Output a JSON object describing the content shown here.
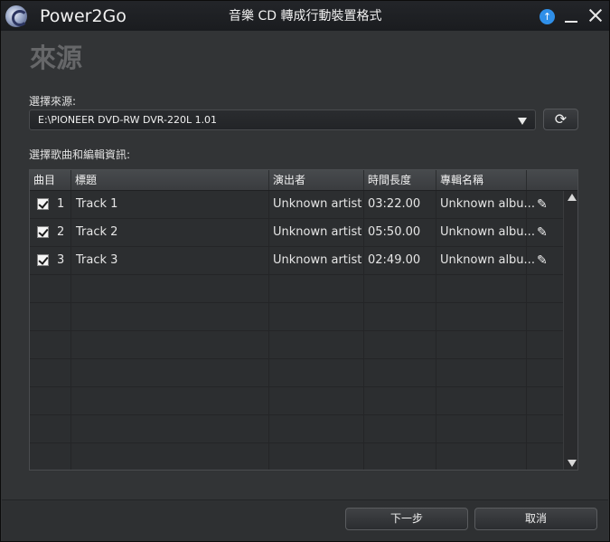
{
  "titlebar": {
    "app_name": "Power2Go",
    "window_title": "音樂 CD 轉成行動裝置格式",
    "update_icon": "arrow-up-circle-icon",
    "update_glyph": "↑"
  },
  "page": {
    "heading": "來源"
  },
  "source": {
    "label": "選擇來源:",
    "selected": "E:\\PIONEER DVD-RW DVR-220L 1.01",
    "refresh_glyph": "⟳"
  },
  "tracks": {
    "label": "選擇歌曲和編輯資訊:",
    "columns": [
      "曲目",
      "標題",
      "演出者",
      "時間長度",
      "專輯名稱",
      ""
    ],
    "rows": [
      {
        "checked": true,
        "num": "1",
        "title": "Track 1",
        "artist": "Unknown artist",
        "duration": "03:22.00",
        "album": "Unknown albu..."
      },
      {
        "checked": true,
        "num": "2",
        "title": "Track 2",
        "artist": "Unknown artist",
        "duration": "05:50.00",
        "album": "Unknown albu..."
      },
      {
        "checked": true,
        "num": "3",
        "title": "Track 3",
        "artist": "Unknown artist",
        "duration": "02:49.00",
        "album": "Unknown albu..."
      }
    ],
    "edit_glyph": "✎"
  },
  "footer": {
    "next_label": "下一步",
    "cancel_label": "取消"
  }
}
